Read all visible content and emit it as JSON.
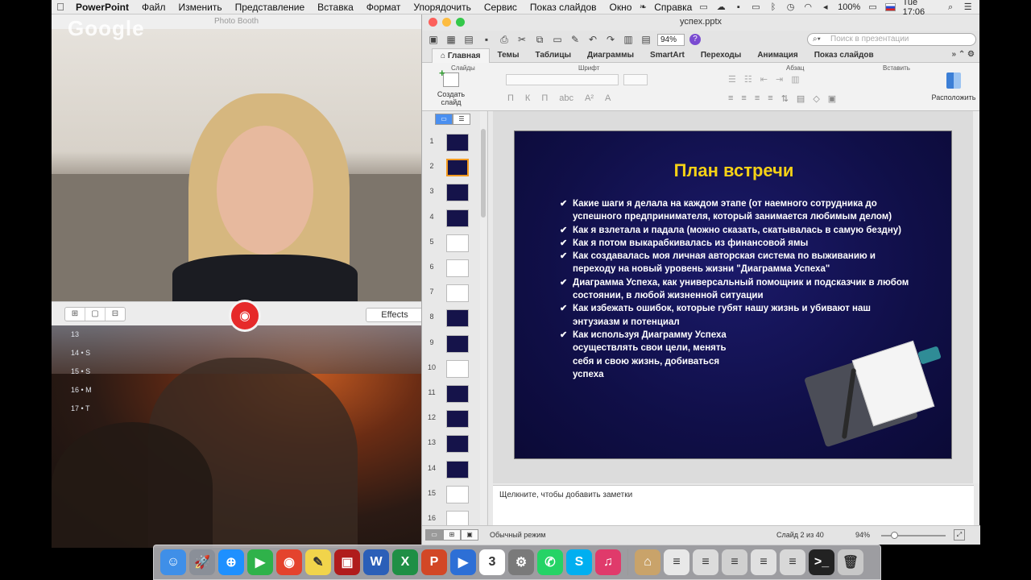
{
  "menubar": {
    "apple": "",
    "items": [
      "PowerPoint",
      "Файл",
      "Изменить",
      "Представление",
      "Вставка",
      "Формат",
      "Упорядочить",
      "Сервис",
      "Показ слайдов",
      "Окно",
      "Справка"
    ],
    "battery": "100%",
    "clock": "Tue 17:06"
  },
  "photobooth": {
    "title": "Photo Booth",
    "overlay_logo": "Google",
    "effects_label": "Effects",
    "layout_icons": [
      "⊞",
      "▢",
      "⊟"
    ]
  },
  "desktop": {
    "calendar_lines": [
      "13",
      "14 • S",
      "15 • S",
      "16 • M",
      "17 • T"
    ]
  },
  "ppt": {
    "filename": "успех.pptx",
    "zoom": "94%",
    "search_placeholder": "Поиск в презентации",
    "tabs": [
      "Главная",
      "Темы",
      "Таблицы",
      "Диаграммы",
      "SmartArt",
      "Переходы",
      "Анимация",
      "Показ слайдов"
    ],
    "ribbon": {
      "group_slides": "Слайды",
      "group_font": "Шрифт",
      "group_paragraph": "Абзац",
      "group_insert": "Вставить",
      "new_slide": "Создать слайд",
      "arrange": "Расположить"
    },
    "thumbnails": [
      "1",
      "2",
      "3",
      "4",
      "5",
      "6",
      "7",
      "8",
      "9",
      "10",
      "11",
      "12",
      "13",
      "14",
      "15",
      "16"
    ],
    "slide": {
      "title": "План встречи",
      "bullets": [
        "Какие шаги я делала на каждом этапе (от наемного сотрудника до успешного предпринимателя, который занимается любимым делом)",
        "Как я взлетала и падала (можно сказать, скатывалась в самую бездну)",
        "Как я потом выкарабкивалась из финансовой ямы",
        "Как создавалась моя личная авторская система по выживанию и переходу на новый уровень жизни \"Диаграмма Успеха\"",
        "Диаграмма Успеха, как универсальный помощник и подсказчик в любом состоянии, в любой жизненной ситуации",
        "Как избежать ошибок, которые губят нашу жизнь и убивают наш энтузиазм и потенциал",
        "Как используя Диаграмму Успеха осуществлять свои цели, менять себя и свою жизнь, добиваться успеха"
      ]
    },
    "notes_placeholder": "Щелкните, чтобы добавить заметки",
    "status": {
      "mode": "Обычный режим",
      "slide_position": "Слайд 2 из 40",
      "zoom": "94%"
    }
  },
  "dock": {
    "icons": [
      {
        "name": "finder-icon",
        "glyph": "☺",
        "color": "#3f8fe8"
      },
      {
        "name": "launchpad-icon",
        "glyph": "🚀",
        "color": "#8a8f98"
      },
      {
        "name": "safari-icon",
        "glyph": "⊕",
        "color": "#1e90ff"
      },
      {
        "name": "facetime-icon",
        "glyph": "▶",
        "color": "#2fb24a"
      },
      {
        "name": "chrome-icon",
        "glyph": "◉",
        "color": "#e4432d"
      },
      {
        "name": "stickies-icon",
        "glyph": "✎",
        "color": "#f1d44b"
      },
      {
        "name": "photo-booth-icon",
        "glyph": "▣",
        "color": "#b01c1c"
      },
      {
        "name": "word-icon",
        "glyph": "W",
        "color": "#2b5fb8"
      },
      {
        "name": "excel-icon",
        "glyph": "X",
        "color": "#1f8f45"
      },
      {
        "name": "powerpoint-icon",
        "glyph": "P",
        "color": "#d24726"
      },
      {
        "name": "quicktime-icon",
        "glyph": "▶",
        "color": "#2d6fd6"
      },
      {
        "name": "calendar-icon",
        "glyph": "3",
        "color": "#ffffff"
      },
      {
        "name": "system-preferences-icon",
        "glyph": "⚙",
        "color": "#7a7a7a"
      },
      {
        "name": "whatsapp-icon",
        "glyph": "✆",
        "color": "#25d366"
      },
      {
        "name": "skype-icon",
        "glyph": "S",
        "color": "#00aff0"
      },
      {
        "name": "itunes-icon",
        "glyph": "♫",
        "color": "#e03a6b"
      },
      {
        "name": "home-folder-icon",
        "glyph": "⌂",
        "color": "#c9a36a"
      },
      {
        "name": "document-icon",
        "glyph": "≡",
        "color": "#e8e8e8"
      },
      {
        "name": "document-icon",
        "glyph": "≡",
        "color": "#dcdcdc"
      },
      {
        "name": "document-icon",
        "glyph": "≡",
        "color": "#d0d0d0"
      },
      {
        "name": "document-icon",
        "glyph": "≡",
        "color": "#e0e0e0"
      },
      {
        "name": "document-icon",
        "glyph": "≡",
        "color": "#d8d8d8"
      },
      {
        "name": "terminal-icon",
        "glyph": ">_",
        "color": "#222222"
      },
      {
        "name": "trash-icon",
        "glyph": "🗑",
        "color": "#c8c8c8"
      }
    ]
  }
}
